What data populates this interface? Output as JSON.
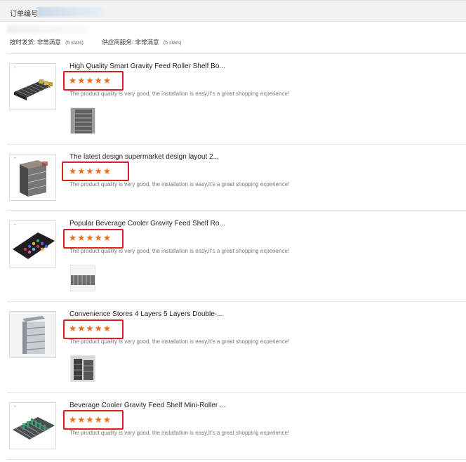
{
  "order": {
    "label": "订单编号"
  },
  "ratings": {
    "delivery_label": "按时发货:",
    "delivery_value": "非常满意",
    "delivery_stars": "(5 stars)",
    "supplier_label": "供应商服务:",
    "supplier_value": "非常满意",
    "supplier_stars": "(5 stars)"
  },
  "reviews": [
    {
      "title": "High Quality Smart Gravity Feed Roller Shelf Bo...",
      "stars": "★★★★★",
      "rating": 5,
      "comment": "The product quality is very good, the installation is easy,It's a great shopping experience!",
      "thumb_mark": "-"
    },
    {
      "title": "The latest design supermarket design layout 2...",
      "stars": "★★★★★",
      "rating": 5,
      "comment": "The product quality is very good, the installation is easy,It's a great shopping experience!",
      "thumb_mark": "-"
    },
    {
      "title": "Popular Beverage Cooler Gravity Feed Shelf Ro...",
      "stars": "★★★★★",
      "rating": 5,
      "comment": "The product quality is very good, the installation is easy,It's a great shopping experience!",
      "thumb_mark": "-"
    },
    {
      "title": "Convenience Stores 4 Layers 5 Layers Double-...",
      "stars": "★★★★★",
      "rating": 5,
      "comment": "The product quality is very good, the installation is easy,It's a great shopping experience!",
      "thumb_mark": ""
    },
    {
      "title": "Beverage Cooler Gravity Feed Shelf Mini-Roller ...",
      "stars": "★★★★★",
      "rating": 5,
      "comment": "The product quality is very good, the installation is easy,It's a great shopping experience!",
      "thumb_mark": "-"
    }
  ],
  "colors": {
    "star": "#ef6c1a",
    "highlight_box": "#e02020",
    "header_bg": "#f2f2f2"
  }
}
